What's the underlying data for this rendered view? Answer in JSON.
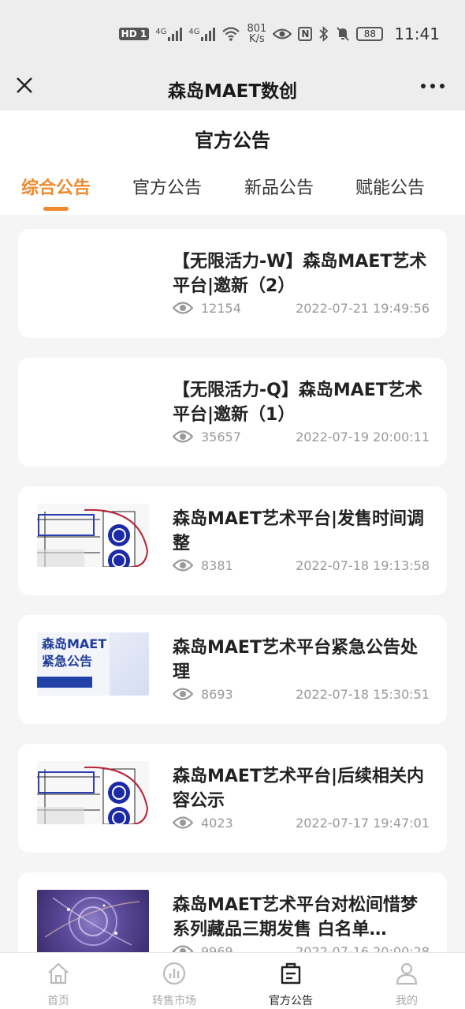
{
  "status_bar": {
    "hd": "HD",
    "hd_sim": "1",
    "network1": "4G",
    "network2": "4G",
    "speed_top": "801",
    "speed_bottom": "K/s",
    "nfc": "N",
    "battery": "88",
    "time": "11:41"
  },
  "navbar": {
    "title": "森岛MAET数创",
    "close_icon": "close-icon",
    "more_icon": "more-icon"
  },
  "page": {
    "title": "官方公告",
    "tabs": [
      {
        "label": "综合公告",
        "active": true
      },
      {
        "label": "官方公告",
        "active": false
      },
      {
        "label": "新品公告",
        "active": false
      },
      {
        "label": "赋能公告",
        "active": false
      }
    ],
    "accent_color": "#ef8a2e"
  },
  "announcements": [
    {
      "title": "【无限活力-W】森岛MAET艺术平台|邀新（2）",
      "views": "12154",
      "date": "2022-07-21 19:49:56",
      "thumb": "none"
    },
    {
      "title": "【无限活力-Q】森岛MAET艺术平台|邀新（1）",
      "views": "35657",
      "date": "2022-07-19 20:00:11",
      "thumb": "none"
    },
    {
      "title": "森岛MAET艺术平台|发售时间调整",
      "views": "8381",
      "date": "2022-07-18 19:13:58",
      "thumb": "art"
    },
    {
      "title": "森岛MAET艺术平台紧急公告处理",
      "views": "8693",
      "date": "2022-07-18 15:30:51",
      "thumb": "notice",
      "thumb_text": [
        "森岛MAET",
        "紧急公告"
      ]
    },
    {
      "title": "森岛MAET艺术平台|后续相关内容公示",
      "views": "4023",
      "date": "2022-07-17 19:47:01",
      "thumb": "art"
    },
    {
      "title": "森岛MAET艺术平台对松间惜梦系列藏品三期发售 白名单…",
      "views": "9969",
      "date": "2022-07-16 20:00:28",
      "thumb": "purple"
    }
  ],
  "tabbar": [
    {
      "label": "首页",
      "icon": "home-icon",
      "active": false
    },
    {
      "label": "转售市场",
      "icon": "market-chart-icon",
      "active": false
    },
    {
      "label": "官方公告",
      "icon": "announcement-icon",
      "active": true
    },
    {
      "label": "我的",
      "icon": "profile-icon",
      "active": false
    }
  ]
}
